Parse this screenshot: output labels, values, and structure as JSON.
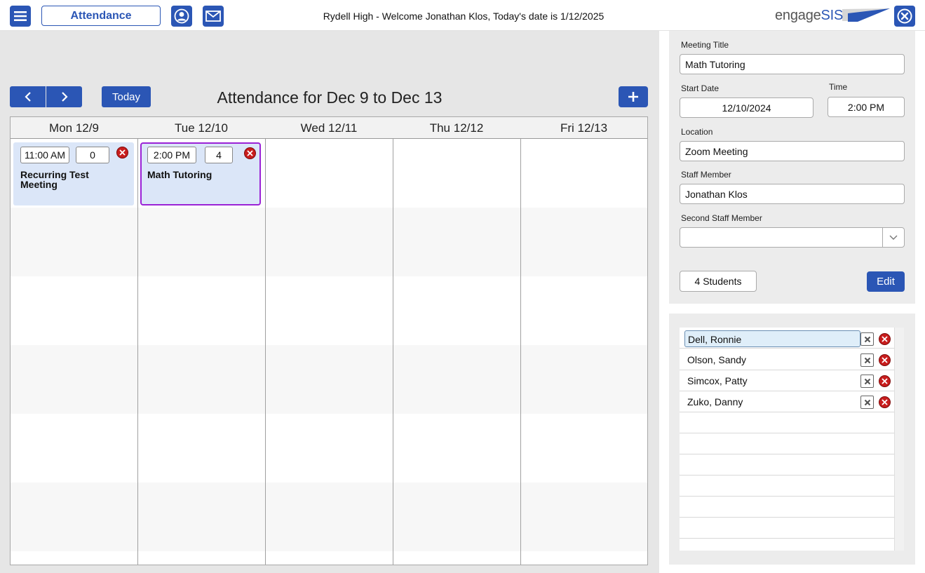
{
  "header": {
    "module_label": "Attendance",
    "welcome_text": "Rydell High - Welcome Jonathan Klos, Today's date is 1/12/2025",
    "logo": {
      "engage": "engage",
      "sis": "SIS"
    },
    "icons": [
      "menu-icon",
      "person-icon",
      "mail-icon",
      "close-icon"
    ]
  },
  "calendar": {
    "today_label": "Today",
    "title": "Attendance for Dec 9 to Dec 13",
    "days": [
      "Mon 12/9",
      "Tue 12/10",
      "Wed 12/11",
      "Thu 12/12",
      "Fri 12/13"
    ],
    "events": [
      {
        "day": "Mon 12/9",
        "time": "11:00 AM",
        "count": "0",
        "title_line1": "Recurring Test",
        "title_line2": "Meeting",
        "selected": false
      },
      {
        "day": "Tue 12/10",
        "time": "2:00 PM",
        "count": "4",
        "title_line1": "Math Tutoring",
        "title_line2": "",
        "selected": true
      }
    ]
  },
  "meeting_form": {
    "title_label": "Meeting Title",
    "title_value": "Math Tutoring",
    "start_date_label": "Start Date",
    "start_date_value": "12/10/2024",
    "time_label": "Time",
    "time_value": "2:00 PM",
    "location_label": "Location",
    "location_value": "Zoom Meeting",
    "staff_label": "Staff Member",
    "staff_value": "Jonathan Klos",
    "second_staff_label": "Second Staff Member",
    "second_staff_value": "",
    "students_button": "4 Students",
    "edit_button": "Edit"
  },
  "students": [
    "Dell, Ronnie",
    "Olson, Sandy",
    "Simcox, Patty",
    "Zuko, Danny"
  ],
  "colors": {
    "accent": "#2b56b5",
    "event_bg": "#dbe6f8",
    "selected_border": "#9b22d6",
    "delete_red": "#c81d1d"
  }
}
